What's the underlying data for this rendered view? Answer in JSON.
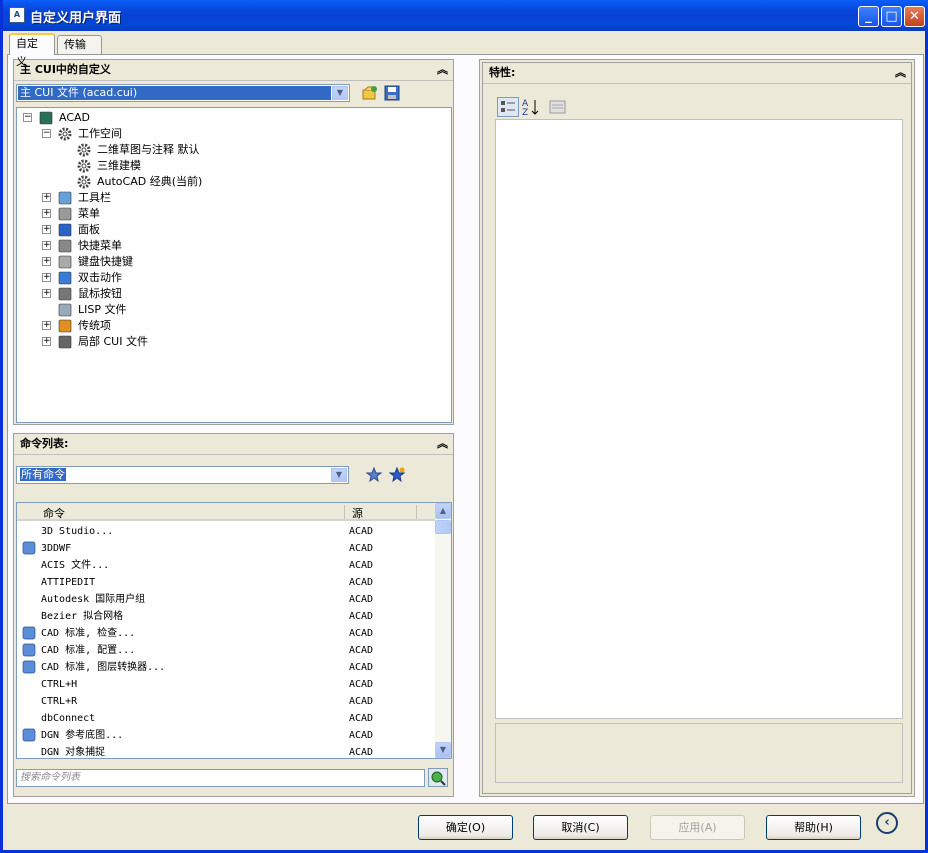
{
  "window": {
    "title": "自定义用户界面",
    "controls": [
      "minimize",
      "maximize",
      "close"
    ]
  },
  "tabs": [
    {
      "label": "自定义",
      "active": true
    },
    {
      "label": "传输",
      "active": false
    }
  ],
  "customize_panel": {
    "title": "主 CUI中的自定义",
    "file_combo": "主 CUI 文件 (acad.cui)",
    "tree": [
      {
        "label": "ACAD",
        "level": 0,
        "expander": "−",
        "icon": "acad-icon"
      },
      {
        "label": "工作空间",
        "level": 1,
        "expander": "−",
        "icon": "gear-icon"
      },
      {
        "label": "二维草图与注释 默认",
        "level": 2,
        "expander": "",
        "icon": "gear-icon"
      },
      {
        "label": "三维建模",
        "level": 2,
        "expander": "",
        "icon": "gear-icon"
      },
      {
        "label": "AutoCAD 经典(当前)",
        "level": 2,
        "expander": "",
        "icon": "gear-icon"
      },
      {
        "label": "工具栏",
        "level": 1,
        "expander": "+",
        "icon": "toolbar-icon"
      },
      {
        "label": "菜单",
        "level": 1,
        "expander": "+",
        "icon": "menu-icon"
      },
      {
        "label": "面板",
        "level": 1,
        "expander": "+",
        "icon": "panel-icon"
      },
      {
        "label": "快捷菜单",
        "level": 1,
        "expander": "+",
        "icon": "shortcut-menu-icon"
      },
      {
        "label": "键盘快捷键",
        "level": 1,
        "expander": "+",
        "icon": "keyboard-icon"
      },
      {
        "label": "双击动作",
        "level": 1,
        "expander": "+",
        "icon": "double-click-icon"
      },
      {
        "label": "鼠标按钮",
        "level": 1,
        "expander": "+",
        "icon": "mouse-icon"
      },
      {
        "label": "LISP 文件",
        "level": 1,
        "expander": "",
        "icon": "lisp-icon"
      },
      {
        "label": "传统项",
        "level": 1,
        "expander": "+",
        "icon": "legacy-icon"
      },
      {
        "label": "局部 CUI 文件",
        "level": 1,
        "expander": "+",
        "icon": "cui-file-icon"
      }
    ]
  },
  "command_panel": {
    "title": "命令列表:",
    "filter_combo": "所有命令",
    "columns": [
      "命令",
      "源"
    ],
    "rows": [
      {
        "name": "3D Studio...",
        "source": "ACAD",
        "icon": ""
      },
      {
        "name": "3DDWF",
        "source": "ACAD",
        "icon": "globe-icon"
      },
      {
        "name": "ACIS 文件...",
        "source": "ACAD",
        "icon": ""
      },
      {
        "name": "ATTIPEDIT",
        "source": "ACAD",
        "icon": ""
      },
      {
        "name": "Autodesk 国际用户组",
        "source": "ACAD",
        "icon": ""
      },
      {
        "name": "Bezier 拟合网格",
        "source": "ACAD",
        "icon": ""
      },
      {
        "name": "CAD 标准, 检查...",
        "source": "ACAD",
        "icon": "check-icon"
      },
      {
        "name": "CAD 标准, 配置...",
        "source": "ACAD",
        "icon": "config-icon"
      },
      {
        "name": "CAD 标准, 图层转换器...",
        "source": "ACAD",
        "icon": "layer-icon"
      },
      {
        "name": "CTRL+H",
        "source": "ACAD",
        "icon": ""
      },
      {
        "name": "CTRL+R",
        "source": "ACAD",
        "icon": ""
      },
      {
        "name": "dbConnect",
        "source": "ACAD",
        "icon": ""
      },
      {
        "name": "DGN 参考底图...",
        "source": "ACAD",
        "icon": "dgn-icon"
      },
      {
        "name": "DGN 对象捕捉",
        "source": "ACAD",
        "icon": ""
      }
    ],
    "search_placeholder": "搜索命令列表"
  },
  "properties_panel": {
    "title": "特性:"
  },
  "buttons": {
    "ok": "确定(O)",
    "cancel": "取消(C)",
    "apply": "应用(A)",
    "help": "帮助(H)"
  }
}
